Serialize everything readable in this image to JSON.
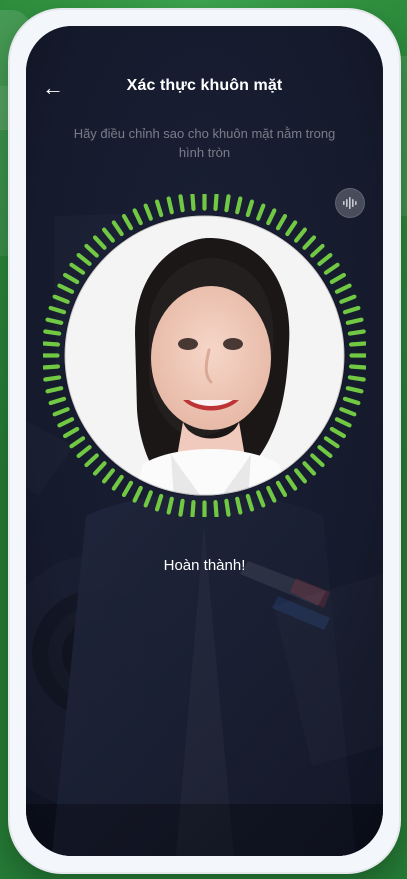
{
  "header": {
    "title": "Xác thực khuôn mặt",
    "back_glyph": "←"
  },
  "instruction": {
    "line1": "Hãy điều chỉnh sao cho khuôn mặt nằm trong",
    "line2": "hình tròn"
  },
  "status": {
    "text": "Hoàn thành!"
  },
  "icons": {
    "back": "back-arrow-icon",
    "voice": "voice-wave-icon"
  },
  "colors": {
    "screen_bg": "#161a2c",
    "ring": "#71c943",
    "text_muted": "rgba(255,255,255,0.42)"
  }
}
